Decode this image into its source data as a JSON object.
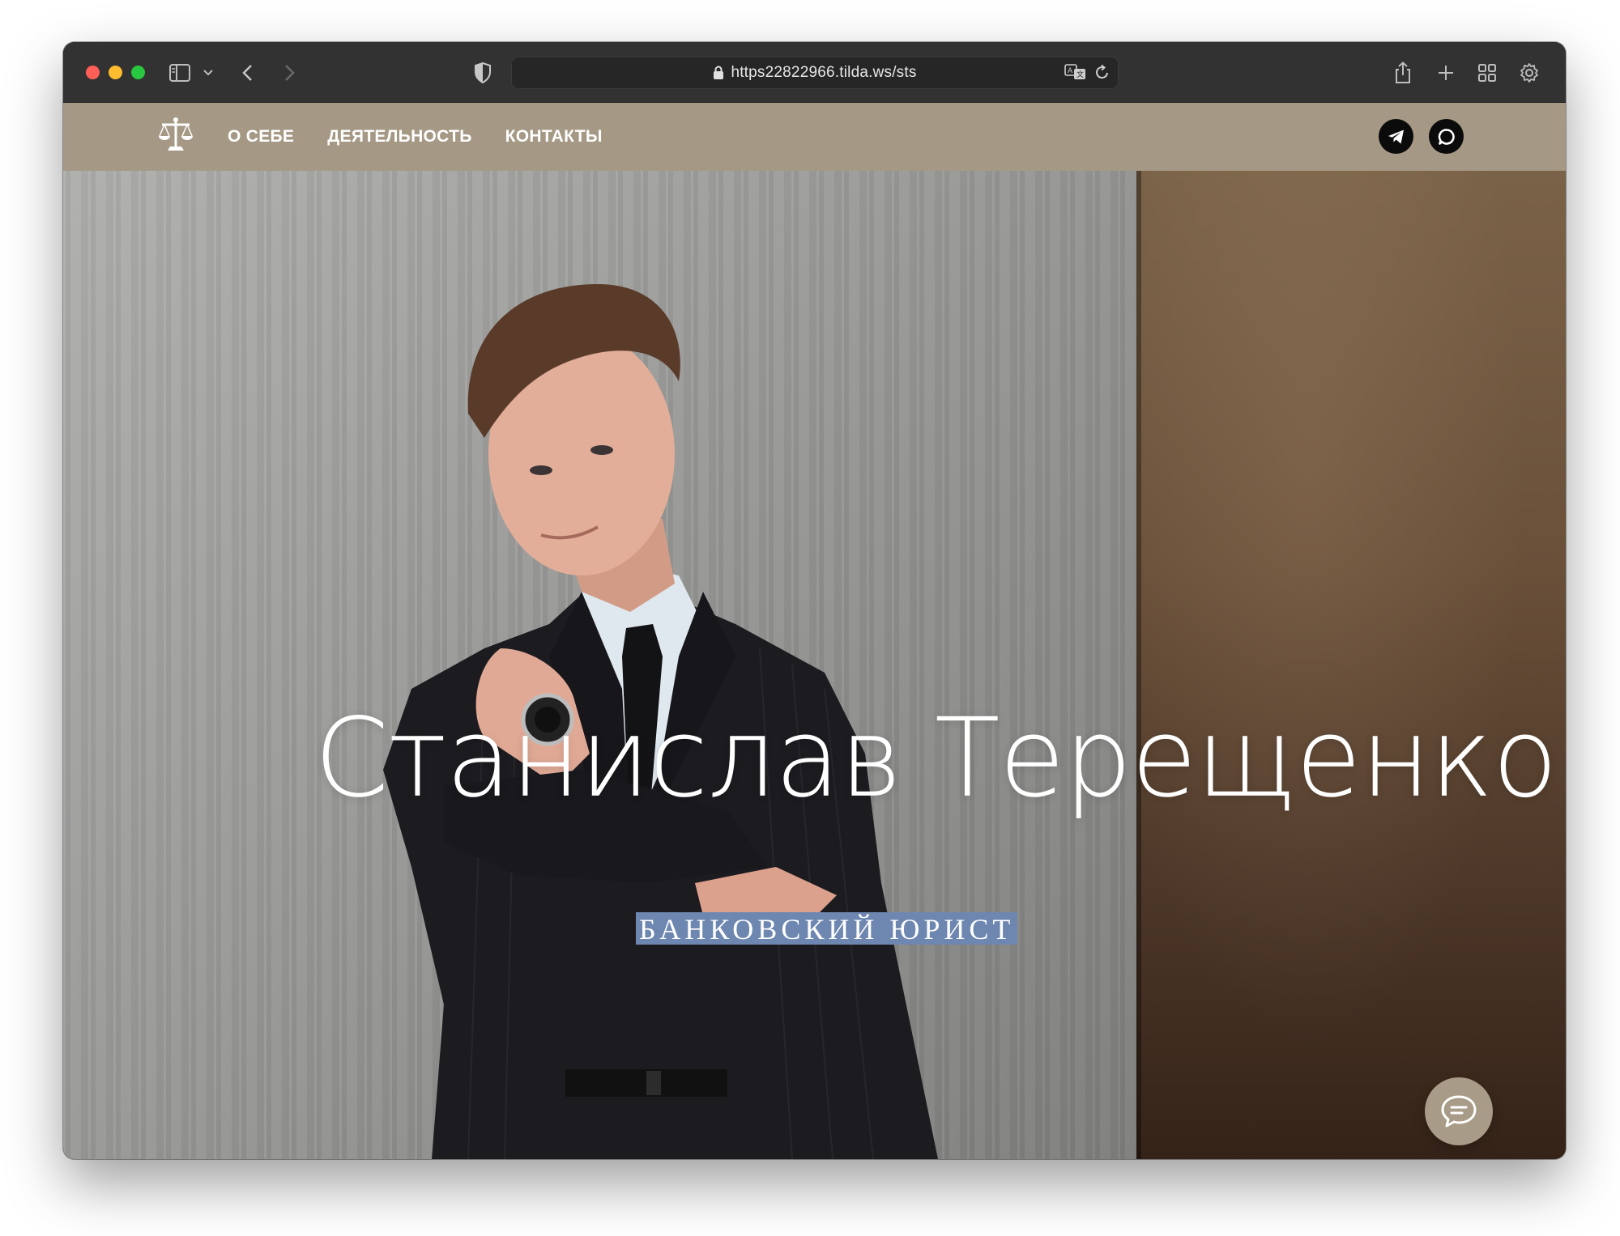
{
  "browser": {
    "url": "https22822966.tilda.ws/sts",
    "traffic_lights": [
      "close",
      "minimize",
      "zoom"
    ],
    "icons": [
      "sidebar-icon",
      "chevron-down-icon",
      "back-icon",
      "forward-icon",
      "privacy-shield-icon",
      "lock-icon",
      "translate-icon",
      "reload-icon",
      "share-icon",
      "new-tab-icon",
      "tab-overview-icon",
      "settings-icon"
    ]
  },
  "site": {
    "logo_icon": "scales-of-justice-icon",
    "nav": [
      "О СЕБЕ",
      "ДЕЯТЕЛЬНОСТЬ",
      "КОНТАКТЫ"
    ],
    "social": [
      "telegram-icon",
      "whatsapp-icon"
    ],
    "header_color": "#a59985"
  },
  "hero": {
    "title": "Станислав Терещенко",
    "subtitle": "БАНКОВСКИЙ ЮРИСТ",
    "subtitle_bg": "#6e87b1",
    "chat_icon": "chat-bubble-icon"
  }
}
